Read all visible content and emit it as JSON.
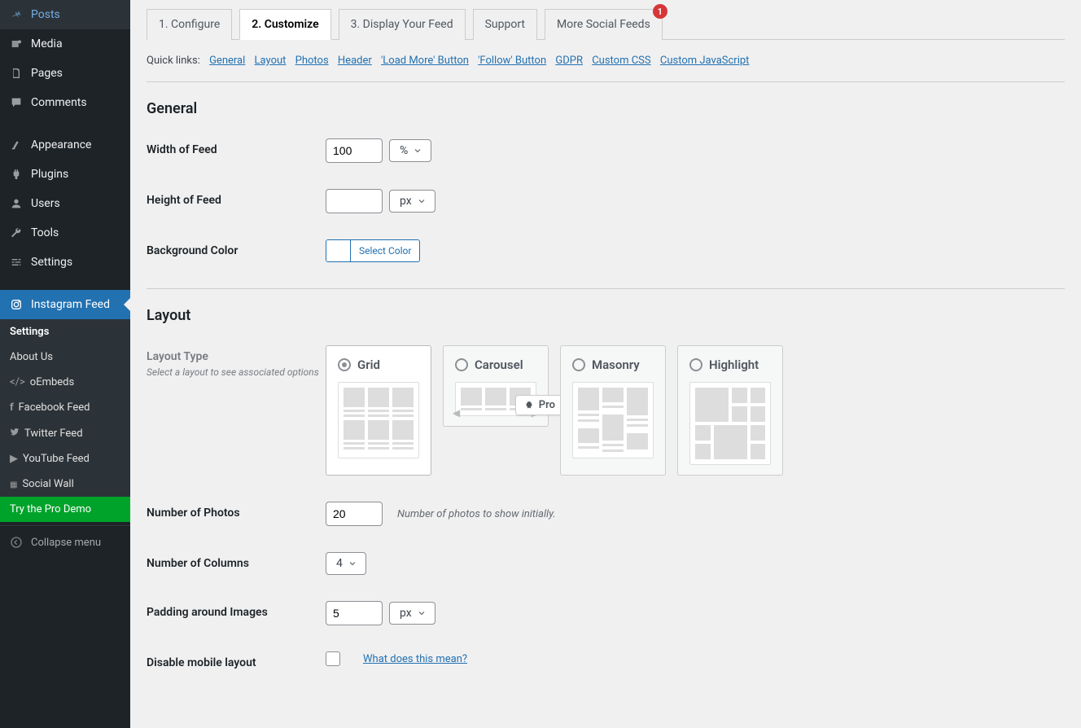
{
  "sidebar": {
    "items": [
      {
        "label": "Posts",
        "icon": "pin"
      },
      {
        "label": "Media",
        "icon": "media"
      },
      {
        "label": "Pages",
        "icon": "page"
      },
      {
        "label": "Comments",
        "icon": "comment"
      },
      {
        "label": "Appearance",
        "icon": "brush"
      },
      {
        "label": "Plugins",
        "icon": "plug"
      },
      {
        "label": "Users",
        "icon": "user"
      },
      {
        "label": "Tools",
        "icon": "wrench"
      },
      {
        "label": "Settings",
        "icon": "sliders"
      },
      {
        "label": "Instagram Feed",
        "icon": "camera",
        "active": true
      }
    ],
    "submenu": [
      {
        "label": "Settings",
        "active": true
      },
      {
        "label": "About Us"
      },
      {
        "label": "oEmbeds",
        "icon": "code"
      },
      {
        "label": "Facebook Feed",
        "icon": "fb"
      },
      {
        "label": "Twitter Feed",
        "icon": "tw"
      },
      {
        "label": "YouTube Feed",
        "icon": "yt"
      },
      {
        "label": "Social Wall",
        "icon": "grid"
      },
      {
        "label": "Try the Pro Demo",
        "promo": true
      }
    ],
    "collapse": "Collapse menu"
  },
  "tabs": [
    "1. Configure",
    "2. Customize",
    "3. Display Your Feed",
    "Support",
    "More Social Feeds"
  ],
  "tabs_badge": "1",
  "quicklinks_label": "Quick links:",
  "quicklinks": [
    "General",
    "Layout",
    "Photos",
    "Header",
    "'Load More' Button",
    "'Follow' Button",
    "GDPR",
    "Custom CSS",
    "Custom JavaScript"
  ],
  "sections": {
    "general": {
      "title": "General",
      "width_label": "Width of Feed",
      "width_value": "100",
      "width_unit": "%",
      "height_label": "Height of Feed",
      "height_value": "",
      "height_unit": "px",
      "bgcolor_label": "Background Color",
      "bgcolor_btn": "Select Color"
    },
    "layout": {
      "title": "Layout",
      "type_label": "Layout Type",
      "type_sub": "Select a layout to see associated options",
      "options": [
        "Grid",
        "Carousel",
        "Masonry",
        "Highlight"
      ],
      "pro_tag": "Pro",
      "num_photos_label": "Number of Photos",
      "num_photos_value": "20",
      "num_photos_help": "Number of photos to show initially.",
      "num_cols_label": "Number of Columns",
      "num_cols_value": "4",
      "padding_label": "Padding around Images",
      "padding_value": "5",
      "padding_unit": "px",
      "disable_mobile_label": "Disable mobile layout",
      "disable_mobile_link": "What does this mean?"
    }
  }
}
